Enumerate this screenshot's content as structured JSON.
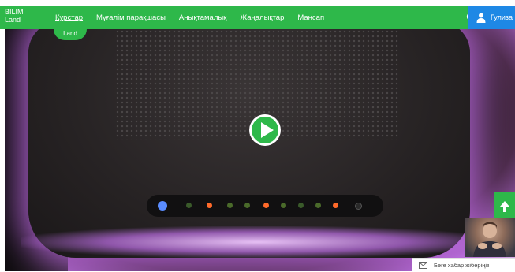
{
  "brand": {
    "line1": "BILIM",
    "line2": "Land",
    "video_badge": "Land",
    "accent": "#2eb84a"
  },
  "nav": {
    "items": [
      {
        "label": "Курстар",
        "active": true
      },
      {
        "label": "Мұғалім парақшасы",
        "active": false
      },
      {
        "label": "Анықтамалық",
        "active": false
      },
      {
        "label": "Жаңалықтар",
        "active": false
      },
      {
        "label": "Мансап",
        "active": false
      }
    ],
    "search_icon": "search-icon"
  },
  "user": {
    "name": "Гулиза",
    "icon": "user-icon",
    "color": "#1e88e5"
  },
  "video": {
    "play_icon": "play-icon"
  },
  "scroll_top": {
    "icon": "arrow-up-icon"
  },
  "feedback": {
    "label": "Бөге хабар жіберіңіз",
    "icon": "mail-icon"
  }
}
